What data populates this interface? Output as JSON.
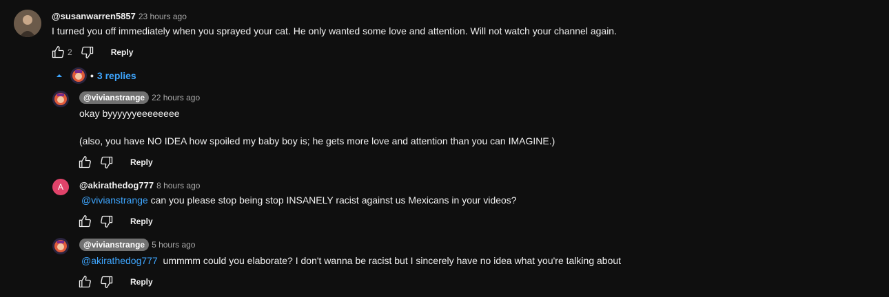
{
  "comment": {
    "author": "@susanwarren5857",
    "time": "23 hours ago",
    "text": "I turned you off immediately when you sprayed your cat. He only wanted some love and attention. Will not watch your channel again.",
    "likes": "2",
    "reply_label": "Reply",
    "replies_label": "3 replies"
  },
  "replies": [
    {
      "author": "@vivianstrange",
      "time": "22 hours ago",
      "line1": "okay byyyyyyeeeeeeee",
      "line2": "(also, you have NO IDEA how spoiled my baby boy is; he gets more love and attention than you can IMAGINE.)",
      "reply_label": "Reply"
    },
    {
      "author": "@akirathedog777",
      "avatar_letter": "A",
      "time": "8 hours ago",
      "mention": "@vivianstrange",
      "text": " can you please stop being stop INSANELY racist against us Mexicans in your videos?",
      "reply_label": "Reply"
    },
    {
      "author": "@vivianstrange",
      "time": "5 hours ago",
      "mention": "@akirathedog777",
      "text": "  ummmm could you elaborate? I don't wanna be racist but I sincerely have no idea what you're talking about",
      "reply_label": "Reply"
    }
  ],
  "colors": {
    "background": "#0f0f0f",
    "link": "#3ea6ff",
    "chip": "#717171",
    "letter_avatar": "#e0436a"
  }
}
